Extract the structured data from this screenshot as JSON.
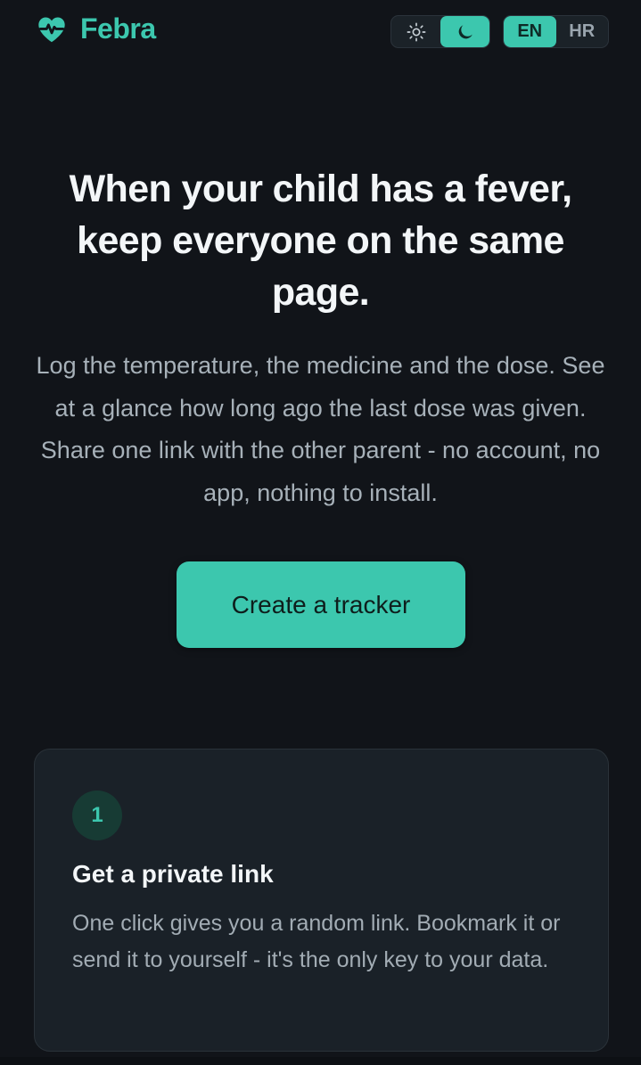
{
  "header": {
    "brand_name": "Febra",
    "theme_toggle": {
      "options": [
        {
          "icon": "sun-icon",
          "label": "Light"
        },
        {
          "icon": "moon-icon",
          "label": "Dark"
        }
      ],
      "selected": "Dark"
    },
    "language_toggle": {
      "options": [
        "EN",
        "HR"
      ],
      "selected": "EN"
    }
  },
  "hero": {
    "title": "When your child has a fever, keep everyone on the same page.",
    "description": "Log the temperature, the medicine and the dose. See at a glance how long ago the last dose was given. Share one link with the other parent - no account, no app, nothing to install.",
    "cta_label": "Create a tracker"
  },
  "steps": [
    {
      "number": "1",
      "title": "Get a private link",
      "text": "One click gives you a random link. Bookmark it or send it to yourself - it's the only key to your data."
    }
  ],
  "colors": {
    "background": "#111419",
    "accent": "#3cc7ae",
    "card": "#1a2128"
  }
}
